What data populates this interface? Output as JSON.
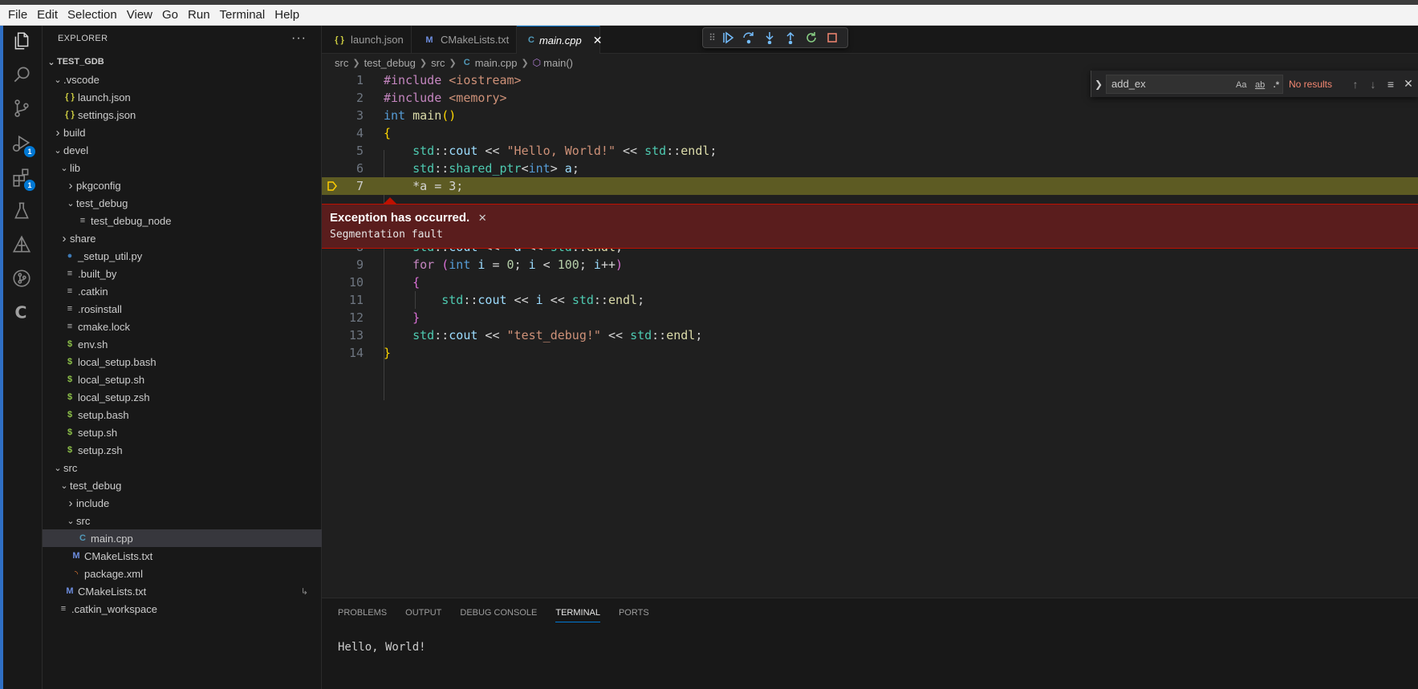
{
  "menu": [
    "File",
    "Edit",
    "Selection",
    "View",
    "Go",
    "Run",
    "Terminal",
    "Help"
  ],
  "activity": {
    "run_debug_badge": "1",
    "extensions_badge": "1"
  },
  "sidebar": {
    "title": "EXPLORER",
    "more": "···",
    "tree": [
      {
        "label": "TEST_GDB",
        "depth": 0,
        "kind": "folder-open",
        "root": true
      },
      {
        "label": ".vscode",
        "depth": 1,
        "kind": "folder-open"
      },
      {
        "label": "launch.json",
        "depth": 2,
        "kind": "json"
      },
      {
        "label": "settings.json",
        "depth": 2,
        "kind": "json"
      },
      {
        "label": "build",
        "depth": 1,
        "kind": "folder-closed"
      },
      {
        "label": "devel",
        "depth": 1,
        "kind": "folder-open"
      },
      {
        "label": "lib",
        "depth": 2,
        "kind": "folder-open"
      },
      {
        "label": "pkgconfig",
        "depth": 3,
        "kind": "folder-closed"
      },
      {
        "label": "test_debug",
        "depth": 3,
        "kind": "folder-open"
      },
      {
        "label": "test_debug_node",
        "depth": 4,
        "kind": "txt"
      },
      {
        "label": "share",
        "depth": 2,
        "kind": "folder-closed"
      },
      {
        "label": "_setup_util.py",
        "depth": 2,
        "kind": "py"
      },
      {
        "label": ".built_by",
        "depth": 2,
        "kind": "txt"
      },
      {
        "label": ".catkin",
        "depth": 2,
        "kind": "txt"
      },
      {
        "label": ".rosinstall",
        "depth": 2,
        "kind": "txt"
      },
      {
        "label": "cmake.lock",
        "depth": 2,
        "kind": "txt"
      },
      {
        "label": "env.sh",
        "depth": 2,
        "kind": "sh"
      },
      {
        "label": "local_setup.bash",
        "depth": 2,
        "kind": "sh"
      },
      {
        "label": "local_setup.sh",
        "depth": 2,
        "kind": "sh"
      },
      {
        "label": "local_setup.zsh",
        "depth": 2,
        "kind": "sh"
      },
      {
        "label": "setup.bash",
        "depth": 2,
        "kind": "sh"
      },
      {
        "label": "setup.sh",
        "depth": 2,
        "kind": "sh"
      },
      {
        "label": "setup.zsh",
        "depth": 2,
        "kind": "sh"
      },
      {
        "label": "src",
        "depth": 1,
        "kind": "folder-open"
      },
      {
        "label": "test_debug",
        "depth": 2,
        "kind": "folder-open"
      },
      {
        "label": "include",
        "depth": 3,
        "kind": "folder-closed"
      },
      {
        "label": "src",
        "depth": 3,
        "kind": "folder-open"
      },
      {
        "label": "main.cpp",
        "depth": 4,
        "kind": "cpp",
        "selected": true
      },
      {
        "label": "CMakeLists.txt",
        "depth": 3,
        "kind": "cmake"
      },
      {
        "label": "package.xml",
        "depth": 3,
        "kind": "xml"
      },
      {
        "label": "CMakeLists.txt",
        "depth": 2,
        "kind": "cmake",
        "deco": "↳"
      },
      {
        "label": ".catkin_workspace",
        "depth": 1,
        "kind": "txt"
      }
    ]
  },
  "tabs": [
    {
      "label": "launch.json",
      "kind": "json",
      "active": false
    },
    {
      "label": "CMakeLists.txt",
      "kind": "cmake",
      "active": false
    },
    {
      "label": "main.cpp",
      "kind": "cpp",
      "active": true
    }
  ],
  "tab_close": "✕",
  "breadcrumb": [
    "src",
    "test_debug",
    "src",
    "main.cpp",
    "main()"
  ],
  "find": {
    "value": "add_ex",
    "opt_case": "Aa",
    "opt_word": "ab",
    "opt_regex": ".*",
    "result": "No results"
  },
  "editor": {
    "current_line": 7,
    "lines": [
      [
        [
          "#include ",
          "pp"
        ],
        [
          "<iostream>",
          "inc"
        ]
      ],
      [
        [
          "#include ",
          "pp"
        ],
        [
          "<memory>",
          "inc"
        ]
      ],
      [
        [
          "int",
          "kw"
        ],
        [
          " ",
          "op"
        ],
        [
          "main",
          "fn"
        ],
        [
          "()",
          "br1"
        ]
      ],
      [
        [
          "{",
          "br1"
        ]
      ],
      [
        [
          "    ",
          "op"
        ],
        [
          "std",
          "ns"
        ],
        [
          "::",
          "op"
        ],
        [
          "cout",
          "var"
        ],
        [
          " << ",
          "op"
        ],
        [
          "\"Hello, World!\"",
          "str"
        ],
        [
          " << ",
          "op"
        ],
        [
          "std",
          "ns"
        ],
        [
          "::",
          "op"
        ],
        [
          "endl",
          "fn"
        ],
        [
          ";",
          "op"
        ]
      ],
      [
        [
          "    ",
          "op"
        ],
        [
          "std",
          "ns"
        ],
        [
          "::",
          "op"
        ],
        [
          "shared_ptr",
          "ns"
        ],
        [
          "<",
          "op"
        ],
        [
          "int",
          "kw"
        ],
        [
          "> ",
          "op"
        ],
        [
          "a",
          "var"
        ],
        [
          ";",
          "op"
        ]
      ],
      [
        [
          "    *a = 3;",
          "op"
        ]
      ],
      [
        [
          "    ",
          "op"
        ],
        [
          "std",
          "ns"
        ],
        [
          "::",
          "op"
        ],
        [
          "cout",
          "var"
        ],
        [
          " << *",
          "op"
        ],
        [
          "a",
          "var"
        ],
        [
          " << ",
          "op"
        ],
        [
          "std",
          "ns"
        ],
        [
          "::",
          "op"
        ],
        [
          "endl",
          "fn"
        ],
        [
          ";",
          "op"
        ]
      ],
      [
        [
          "    ",
          "op"
        ],
        [
          "for",
          "ctl"
        ],
        [
          " ",
          "op"
        ],
        [
          "(",
          "br2"
        ],
        [
          "int",
          "kw"
        ],
        [
          " ",
          "op"
        ],
        [
          "i",
          "var"
        ],
        [
          " = ",
          "op"
        ],
        [
          "0",
          "num"
        ],
        [
          "; ",
          "op"
        ],
        [
          "i",
          "var"
        ],
        [
          " < ",
          "op"
        ],
        [
          "100",
          "num"
        ],
        [
          "; ",
          "op"
        ],
        [
          "i",
          "var"
        ],
        [
          "++",
          "op"
        ],
        [
          ")",
          "br2"
        ]
      ],
      [
        [
          "    ",
          "op"
        ],
        [
          "{",
          "br2"
        ]
      ],
      [
        [
          "        ",
          "op"
        ],
        [
          "std",
          "ns"
        ],
        [
          "::",
          "op"
        ],
        [
          "cout",
          "var"
        ],
        [
          " << ",
          "op"
        ],
        [
          "i",
          "var"
        ],
        [
          " << ",
          "op"
        ],
        [
          "std",
          "ns"
        ],
        [
          "::",
          "op"
        ],
        [
          "endl",
          "fn"
        ],
        [
          ";",
          "op"
        ]
      ],
      [
        [
          "    ",
          "op"
        ],
        [
          "}",
          "br2"
        ]
      ],
      [
        [
          "    ",
          "op"
        ],
        [
          "std",
          "ns"
        ],
        [
          "::",
          "op"
        ],
        [
          "cout",
          "var"
        ],
        [
          " << ",
          "op"
        ],
        [
          "\"test_debug!\"",
          "str"
        ],
        [
          " << ",
          "op"
        ],
        [
          "std",
          "ns"
        ],
        [
          "::",
          "op"
        ],
        [
          "endl",
          "fn"
        ],
        [
          ";",
          "op"
        ]
      ],
      [
        [
          "}",
          "br1"
        ]
      ]
    ]
  },
  "exception": {
    "title": "Exception has occurred.",
    "close": "✕",
    "message": "Segmentation fault"
  },
  "panel": {
    "tabs": [
      "PROBLEMS",
      "OUTPUT",
      "DEBUG CONSOLE",
      "TERMINAL",
      "PORTS"
    ],
    "active_tab": "TERMINAL",
    "terminal_output": "Hello, World!"
  },
  "colors": {
    "accent": "#0078d4",
    "exception_bg": "#5a1d1d",
    "current_line_bg": "#5d5b23",
    "find_no_results": "#f48771"
  }
}
